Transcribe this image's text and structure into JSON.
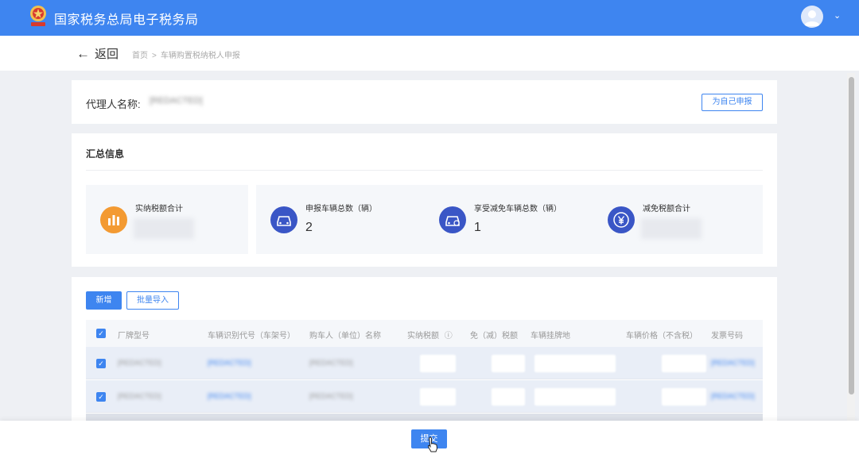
{
  "header": {
    "brand": "国家税务总局电子税务局",
    "brand_color": "#3e85f0",
    "logo_icon": "tax-emblem-icon",
    "user_icon": "user-avatar-icon",
    "menu_chevron": "⌄"
  },
  "breadcrumb": {
    "back_label": "返回",
    "back_arrow": "←",
    "home": "首页",
    "separator": ">",
    "current": "车辆购置税纳税人申报"
  },
  "agent": {
    "label": "代理人名称:",
    "value": "[REDACTED]",
    "self_button": "为自己申报"
  },
  "summary": {
    "title": "汇总信息",
    "stats": [
      {
        "label": "实纳税额合计",
        "value": "",
        "icon": "bar-chart-icon",
        "color": "#f39a32"
      },
      {
        "label": "申报车辆总数（辆）",
        "value": "2",
        "icon": "car-icon",
        "color": "#3a56c6"
      },
      {
        "label": "享受减免车辆总数（辆）",
        "value": "1",
        "icon": "car-discount-icon",
        "color": "#3a56c6"
      },
      {
        "label": "减免税额合计",
        "value": "",
        "icon": "yen-icon",
        "color": "#3a56c6"
      }
    ]
  },
  "table": {
    "add_button": "新增",
    "import_button": "批量导入",
    "columns": [
      "厂牌型号",
      "车辆识别代号（车架号）",
      "购车人（单位）名称",
      "实纳税额",
      "免（减）税额",
      "车辆挂牌地",
      "车辆价格（不含税）",
      "发票号码"
    ],
    "info_icon": "ⓘ",
    "rows": [
      {
        "checked": true,
        "model": "[REDACTED]",
        "vin": "[REDACTED]",
        "buyer": "[REDACTED]",
        "tax": "",
        "exempt": "",
        "location": "",
        "price": "",
        "invoice": "[REDACTED]"
      },
      {
        "checked": true,
        "model": "[REDACTED]",
        "vin": "[REDACTED]",
        "buyer": "[REDACTED]",
        "tax": "",
        "exempt": "",
        "location": "",
        "price": "",
        "invoice": "[REDACTED]"
      }
    ]
  },
  "footer": {
    "submit_label": "提交"
  }
}
